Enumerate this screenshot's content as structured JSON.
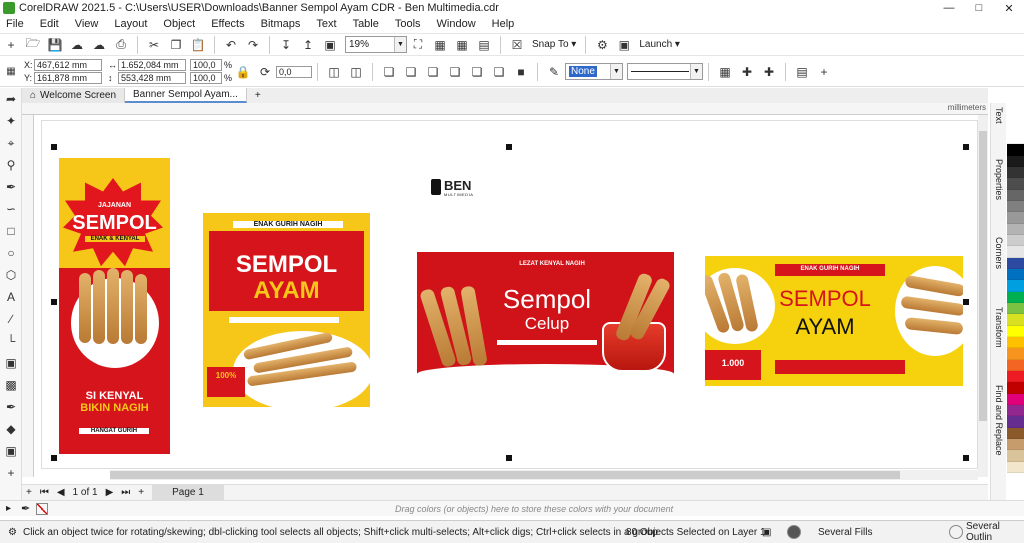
{
  "window": {
    "title": "CorelDRAW 2021.5 - C:\\Users\\USER\\Downloads\\Banner Sempol Ayam CDR - Ben Multimedia.cdr"
  },
  "menu": [
    "File",
    "Edit",
    "View",
    "Layout",
    "Object",
    "Effects",
    "Bitmaps",
    "Text",
    "Table",
    "Tools",
    "Window",
    "Help"
  ],
  "toolbar": {
    "zoom": "19%",
    "snap_to": "Snap To",
    "launch": "Launch"
  },
  "property_bar": {
    "x_label": "X:",
    "x": "467,612 mm",
    "y_label": "Y:",
    "y": "161,878 mm",
    "w": "1.652,084 mm",
    "h": "553,428 mm",
    "scale_w": "100,0",
    "scale_h": "100,0",
    "pct": "%",
    "rotation": "0,0",
    "outline_fill": "None"
  },
  "tabs": [
    "Welcome Screen",
    "Banner Sempol Ayam..."
  ],
  "ruler_unit": "millimeters",
  "canvas": {
    "logo_text": "BEN",
    "logo_sub": "MULTIMEDIA",
    "b1": {
      "title": "SEMPOL",
      "sub1": "JAJANAN",
      "sub2": "ENAK & KENYAL",
      "bottom1": "SI KENYAL",
      "bottom2": "BIKIN NAGIH",
      "tag": "HANGAT GURIH"
    },
    "b2": {
      "top": "ENAK GURIH NAGIH",
      "title1": "SEMPOL",
      "title2": "AYAM",
      "badge": "100%"
    },
    "b3": {
      "top": "LEZAT KENYAL NAGIH",
      "title1": "Sempol",
      "title2": "Celup"
    },
    "b4": {
      "top": "ENAK GURIH NAGIH",
      "title1": "SEMPOL",
      "title2": "AYAM",
      "price": "1.000"
    }
  },
  "dockers": [
    "Text",
    "Properties",
    "Corners",
    "Transform",
    "Find and Replace"
  ],
  "palette": [
    "#ffffff",
    "#000000",
    "#1a1a1a",
    "#333333",
    "#4d4d4d",
    "#666666",
    "#808080",
    "#999999",
    "#b3b3b3",
    "#cccccc",
    "#e6e6e6",
    "#2b4aa0",
    "#0070c0",
    "#00a0e0",
    "#00b050",
    "#7cc242",
    "#d8e021",
    "#ffff00",
    "#ffc000",
    "#f7941d",
    "#f26522",
    "#ed1c24",
    "#c00000",
    "#e0007a",
    "#92278f",
    "#662d91",
    "#8b5a2b",
    "#c69c6d",
    "#d9c39a",
    "#f2e6cc"
  ],
  "pagebar": {
    "count": "1 of 1",
    "page": "Page 1"
  },
  "colorbar": {
    "hint": "Drag colors (or objects) here to store these colors with your document"
  },
  "status": {
    "message": "Click an object twice for rotating/skewing; dbl-clicking tool selects all objects; Shift+click multi-selects; Alt+click digs; Ctrl+click selects in a group",
    "selection": "80 Objects Selected on Layer 1",
    "fill": "Several Fills",
    "outline": "Several Outlin"
  }
}
